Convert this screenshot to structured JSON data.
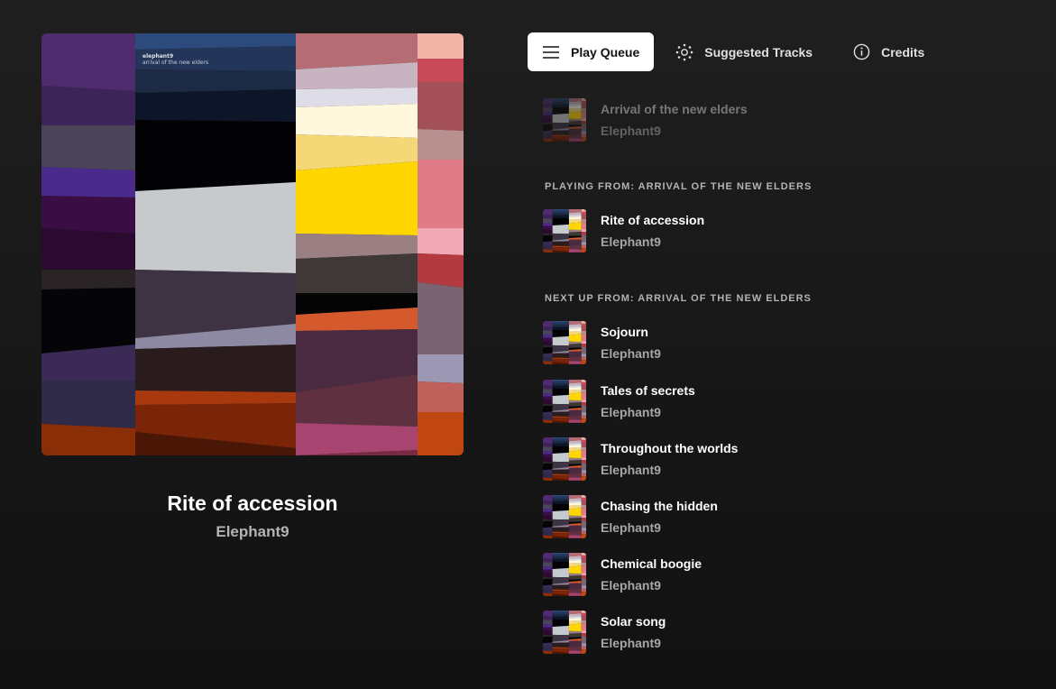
{
  "now_playing": {
    "title": "Rite of accession",
    "artist": "Elephant9",
    "cover_text": {
      "line1": "elephant9",
      "line2": "arrival of the new elders"
    }
  },
  "tabs": [
    {
      "label": "Play Queue",
      "icon": "list-icon",
      "active": true
    },
    {
      "label": "Suggested Tracks",
      "icon": "suggest-dots-icon",
      "active": false
    },
    {
      "label": "Credits",
      "icon": "info-icon",
      "active": false
    }
  ],
  "queue": {
    "previous": [
      {
        "title": "Arrival of the new elders",
        "artist": "Elephant9"
      }
    ],
    "playing_label": "Playing from: Arrival of the new elders",
    "playing": {
      "title": "Rite of accession",
      "artist": "Elephant9"
    },
    "next_label": "Next up from: Arrival of the new elders",
    "next": [
      {
        "title": "Sojourn",
        "artist": "Elephant9"
      },
      {
        "title": "Tales of secrets",
        "artist": "Elephant9"
      },
      {
        "title": "Throughout the worlds",
        "artist": "Elephant9"
      },
      {
        "title": "Chasing the hidden",
        "artist": "Elephant9"
      },
      {
        "title": "Chemical boogie",
        "artist": "Elephant9"
      },
      {
        "title": "Solar song",
        "artist": "Elephant9"
      }
    ]
  },
  "colors": {
    "background": "#1a1a1a",
    "tab_active_bg": "#ffffff",
    "muted_text": "#a7a7a7"
  }
}
